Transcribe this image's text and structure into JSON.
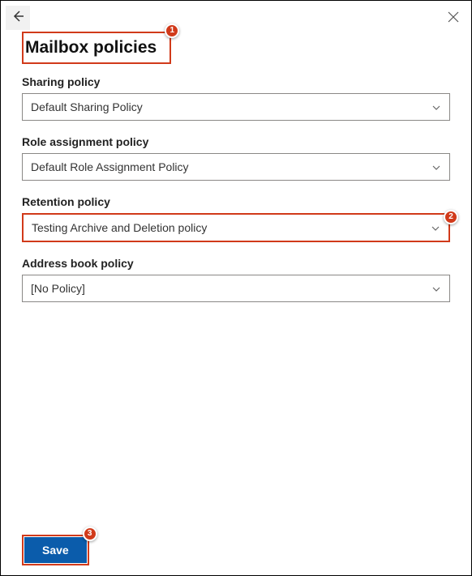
{
  "header": {
    "title": "Mailbox policies"
  },
  "fields": {
    "sharing": {
      "label": "Sharing policy",
      "value": "Default Sharing Policy"
    },
    "role": {
      "label": "Role assignment policy",
      "value": "Default Role Assignment Policy"
    },
    "retention": {
      "label": "Retention policy",
      "value": "Testing Archive and Deletion policy"
    },
    "addressbook": {
      "label": "Address book policy",
      "value": "[No Policy]"
    }
  },
  "footer": {
    "save_label": "Save"
  },
  "callouts": {
    "c1": "1",
    "c2": "2",
    "c3": "3"
  }
}
